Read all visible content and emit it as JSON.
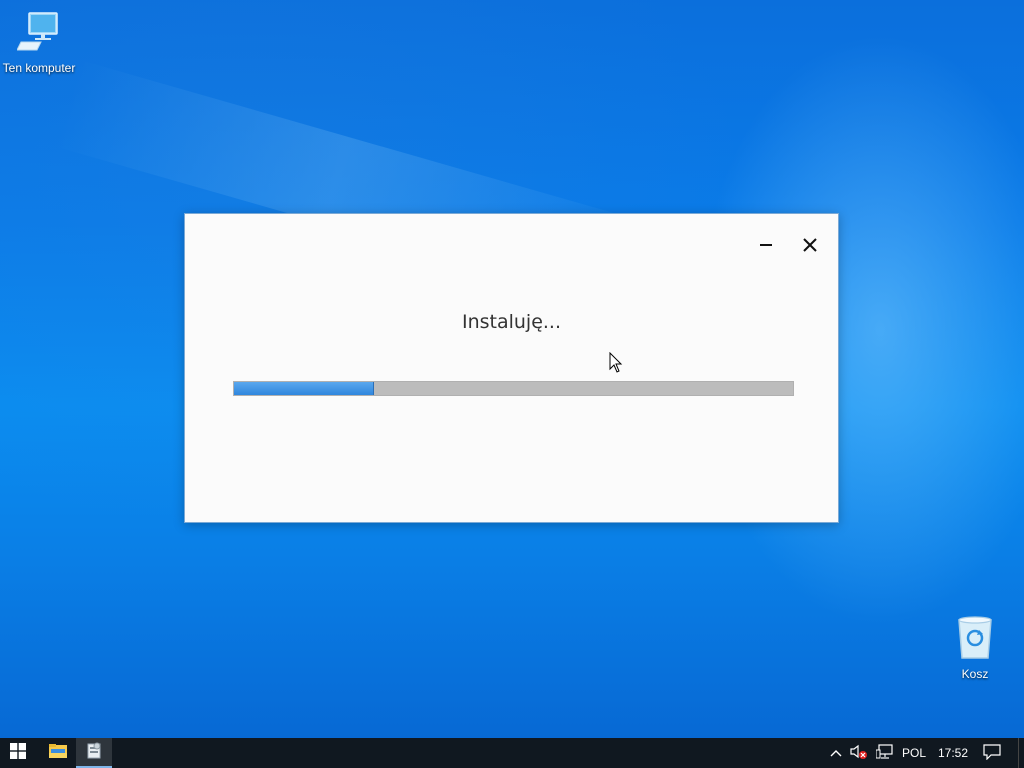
{
  "desktop": {
    "icons": [
      {
        "label": "Ten komputer",
        "icon": "computer-icon"
      },
      {
        "label": "Kosz",
        "icon": "recycle-bin-icon"
      }
    ]
  },
  "installer": {
    "status_text": "Instaluję...",
    "progress": 0.25,
    "controls": {
      "minimize": "minimize-icon",
      "close": "close-icon"
    }
  },
  "taskbar": {
    "start_icon": "windows-logo-icon",
    "pinned": [
      {
        "name": "file-explorer",
        "icon": "folder-icon"
      },
      {
        "name": "installer",
        "icon": "installer-icon",
        "active": true
      }
    ],
    "tray": {
      "chevron_icon": "chevron-up-icon",
      "volume_icon": "volume-muted-icon",
      "network_icon": "network-icon",
      "language": "POL",
      "time": "17:52",
      "action_center_icon": "notification-icon"
    }
  },
  "colors": {
    "progress_fill": "#2f86dd",
    "progress_track": "#bcbcbc",
    "taskbar": "#101820",
    "desktop_blue": "#0a7be8"
  }
}
